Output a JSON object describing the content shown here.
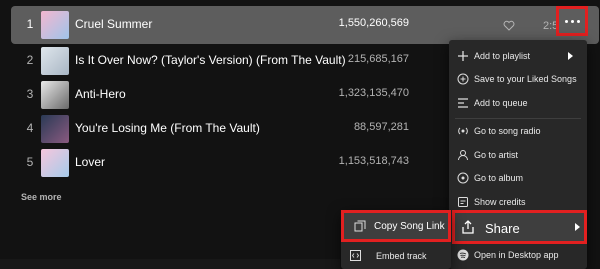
{
  "tracks": [
    {
      "num": "1",
      "title": "Cruel Summer",
      "plays": "1,550,260,569",
      "duration": "2:58"
    },
    {
      "num": "2",
      "title": "Is It Over Now? (Taylor's Version) (From The Vault)",
      "plays": "215,685,167"
    },
    {
      "num": "3",
      "title": "Anti-Hero",
      "plays": "1,323,135,470"
    },
    {
      "num": "4",
      "title": "You're Losing Me (From The Vault)",
      "plays": "88,597,281"
    },
    {
      "num": "5",
      "title": "Lover",
      "plays": "1,153,518,743"
    }
  ],
  "see_more": "See more",
  "menu": {
    "items": [
      {
        "label": "Add to playlist",
        "icon": "plus-icon"
      },
      {
        "label": "Save to your Liked Songs",
        "icon": "plus-circle-icon"
      },
      {
        "label": "Add to queue",
        "icon": "queue-icon"
      },
      {
        "label": "Go to song radio",
        "icon": "radio-icon"
      },
      {
        "label": "Go to artist",
        "icon": "artist-icon"
      },
      {
        "label": "Go to album",
        "icon": "album-icon"
      },
      {
        "label": "Show credits",
        "icon": "credits-icon"
      }
    ],
    "share": "Share",
    "open_desktop": "Open in Desktop app"
  },
  "submenu": {
    "copy_link": "Copy Song Link",
    "embed": "Embed track"
  },
  "colors": {
    "highlight": "#e22020",
    "active_row": "#5d5d5d",
    "menu_bg": "#282828"
  }
}
